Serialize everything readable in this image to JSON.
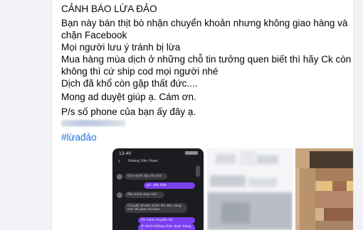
{
  "post": {
    "title": "CẢNH BÁO LỪA ĐẢO",
    "paragraph1_line1": "Bạn này bán thịt bò nhận chuyển khoản nhưng không giao hàng và",
    "paragraph1_line2": "chặn Facebook",
    "paragraph1_line3": "Mọi người lưu ý tránh bị lừa",
    "paragraph1_line4": "Mua hàng mùa dịch ở những chỗ tin tưởng quen biết thì hãy Ck còn",
    "paragraph1_line5": "không thì cứ ship cod mọi người nhé",
    "paragraph1_line6": "Dịch đã khổ còn gặp thất đức....",
    "paragraph2": "Mong ad duyệt giúp ạ. Cám ơn.",
    "paragraph3": "P/s số phone của bạn ấy đây ạ.",
    "hashtag": "#lừađảo",
    "colors": {
      "hashtag": "#216fdb",
      "text": "#050505",
      "chat_accent": "#7b3ff2"
    }
  },
  "chat_screenshot": {
    "time": "12:40",
    "contact_name": "Hoàng Văn Hoan",
    "messages": [
      {
        "side": "in",
        "text": "Cho mình địa chỉ nhé"
      },
      {
        "side": "out",
        "text": "p2...tổn tỉnh"
      },
      {
        "side": "in",
        "text": "Mai mình ship nhé"
      },
      {
        "side": "in",
        "text": "Chuyển khoản mình lên đơn sáng mai để giao cho bạn"
      },
      {
        "side": "out",
        "text": "Ok mình chuyển rồi"
      },
      {
        "side": "out",
        "text": "Ơ mình không nhận được hàng ạ"
      }
    ]
  },
  "icons": [
    "back-arrow-icon",
    "avatar-icon"
  ]
}
